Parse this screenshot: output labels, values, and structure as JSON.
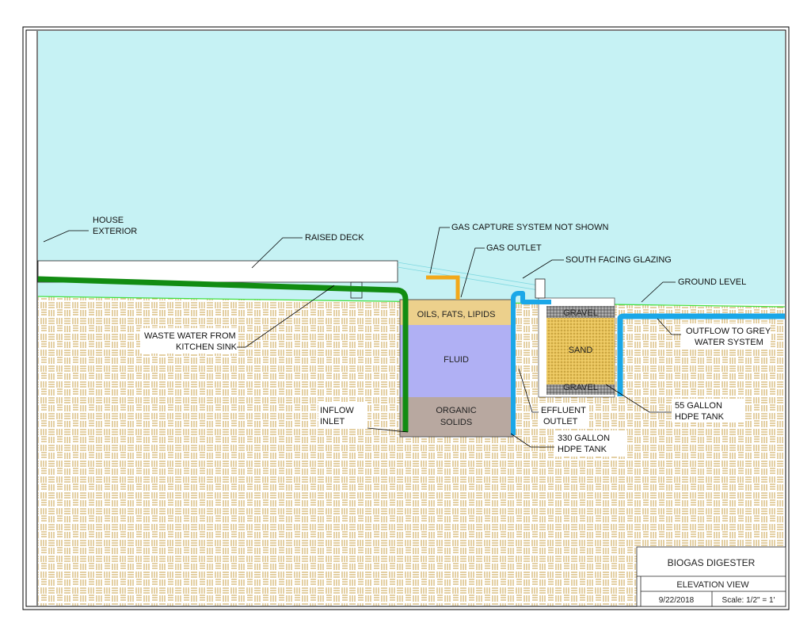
{
  "colors": {
    "sky": "#c6f2f4",
    "ground_pattern": "#c9a24a",
    "waste_pipe": "#128c12",
    "water_pipe": "#1aa7e8",
    "gas_pipe": "#f2a81a",
    "oils_layer": "#ecd08c",
    "fluid_layer": "#b0b0f4",
    "solids_layer": "#b8a8a0",
    "sand": "#e9c35a",
    "gravel": "#8c8c8c",
    "ground_line": "#3fe03f"
  },
  "labels": {
    "house_exterior": [
      "HOUSE",
      "EXTERIOR"
    ],
    "raised_deck": "RAISED DECK",
    "gas_capture": "GAS CAPTURE SYSTEM NOT SHOWN",
    "gas_outlet": "GAS OUTLET",
    "south_glazing": "SOUTH FACING GLAZING",
    "ground_level": "GROUND LEVEL",
    "waste_water": [
      "WASTE WATER FROM",
      "KITCHEN SINK"
    ],
    "outflow": [
      "OUTFLOW TO GREY",
      "WATER SYSTEM"
    ],
    "oils": "OILS, FATS, LIPIDS",
    "fluid": "FLUID",
    "organic_solids": [
      "ORGANIC",
      "SOLIDS"
    ],
    "gravel_top": "GRAVEL",
    "sand": "SAND",
    "gravel_bottom": "GRAVEL",
    "effluent_outlet": [
      "EFFLUENT",
      "OUTLET"
    ],
    "inflow_inlet": [
      "INFLOW",
      "INLET"
    ],
    "tank_330": [
      "330 GALLON",
      "HDPE TANK"
    ],
    "tank_55": [
      "55 GALLON",
      "HDPE TANK"
    ]
  },
  "title_block": {
    "title": "BIOGAS DIGESTER",
    "view": "ELEVATION VIEW",
    "date": "9/22/2018",
    "scale": "Scale: 1/2\" = 1'"
  }
}
